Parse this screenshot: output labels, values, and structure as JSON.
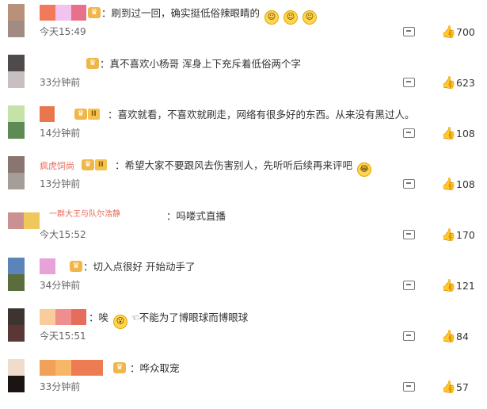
{
  "comments": [
    {
      "avatar_colors": [
        "#b9907a",
        "#a08c82"
      ],
      "name_colors": [
        "#f07a5a",
        "#f2c3ee",
        "#e8708c"
      ],
      "badge": "crown",
      "text": "：刷到过一回，确实挺低俗辣眼睛的",
      "emojis": [
        "☺",
        "☺",
        "☺"
      ],
      "time": "今天15:49",
      "likes": "700"
    },
    {
      "avatar_colors": [
        "#4f4a4b",
        "#c7c0bf"
      ],
      "name_colors": [],
      "badge": "crown",
      "text": "：真不喜欢小杨哥 浑身上下充斥着低俗两个字",
      "emojis": [],
      "time": "33分钟前",
      "likes": "623"
    },
    {
      "avatar_colors": [
        "#c5e3a8",
        "#5e8a54"
      ],
      "name_colors": [
        "#e8774e"
      ],
      "badge": "vip",
      "vip_label": "II",
      "text": "：喜欢就看，不喜欢就刷走，网络有很多好的东西。从来没有黑过人。",
      "emojis": [],
      "time": "14分钟前",
      "likes": "108"
    },
    {
      "avatar_colors": [
        "#8a7670",
        "#a59d98"
      ],
      "name_colors": [],
      "name_fragment": "疯虎饲尚",
      "badge": "vip",
      "vip_label": "II",
      "text": "：希望大家不要跟风去伤害别人，先听听后续再来评吧",
      "emojis": [
        "😂"
      ],
      "time": "13分钟前",
      "likes": "108"
    },
    {
      "avatar_colors": [
        "#c99192",
        "#f0c75a"
      ],
      "name_colors": [],
      "name_fragment": "一群大王与队尔浩静",
      "badge": "none",
      "text": "：吗喽式直播",
      "emojis": [],
      "time": "今大15:52",
      "likes": "170"
    },
    {
      "avatar_colors": [
        "#5b84b8",
        "#5b6d3c"
      ],
      "name_colors": [
        "#e8a2d8"
      ],
      "badge": "crown",
      "text": "：切入点很好 开始动手了",
      "emojis": [],
      "time": "34分钟前",
      "likes": "121"
    },
    {
      "avatar_colors": [
        "#3d332f",
        "#5a3635"
      ],
      "name_colors": [
        "#f9cd9b",
        "#f08d8d",
        "#e46d5e"
      ],
      "badge": "none",
      "text": "：唉",
      "emojis": [
        "😮"
      ],
      "text2": "不能为了博眼球而博眼球",
      "time": "今天15:51",
      "likes": "84"
    },
    {
      "avatar_colors": [
        "#f0dccb",
        "#1a1412"
      ],
      "name_colors": [
        "#f3a05a",
        "#f5b866",
        "#ed7c53"
      ],
      "badge": "crown",
      "text": "：哗众取宠",
      "emojis": [],
      "time": "33分钟前",
      "likes": "57"
    }
  ],
  "icons": {
    "reply": "comment-icon",
    "like": "thumbs-up-icon",
    "crown": "crown-icon"
  }
}
